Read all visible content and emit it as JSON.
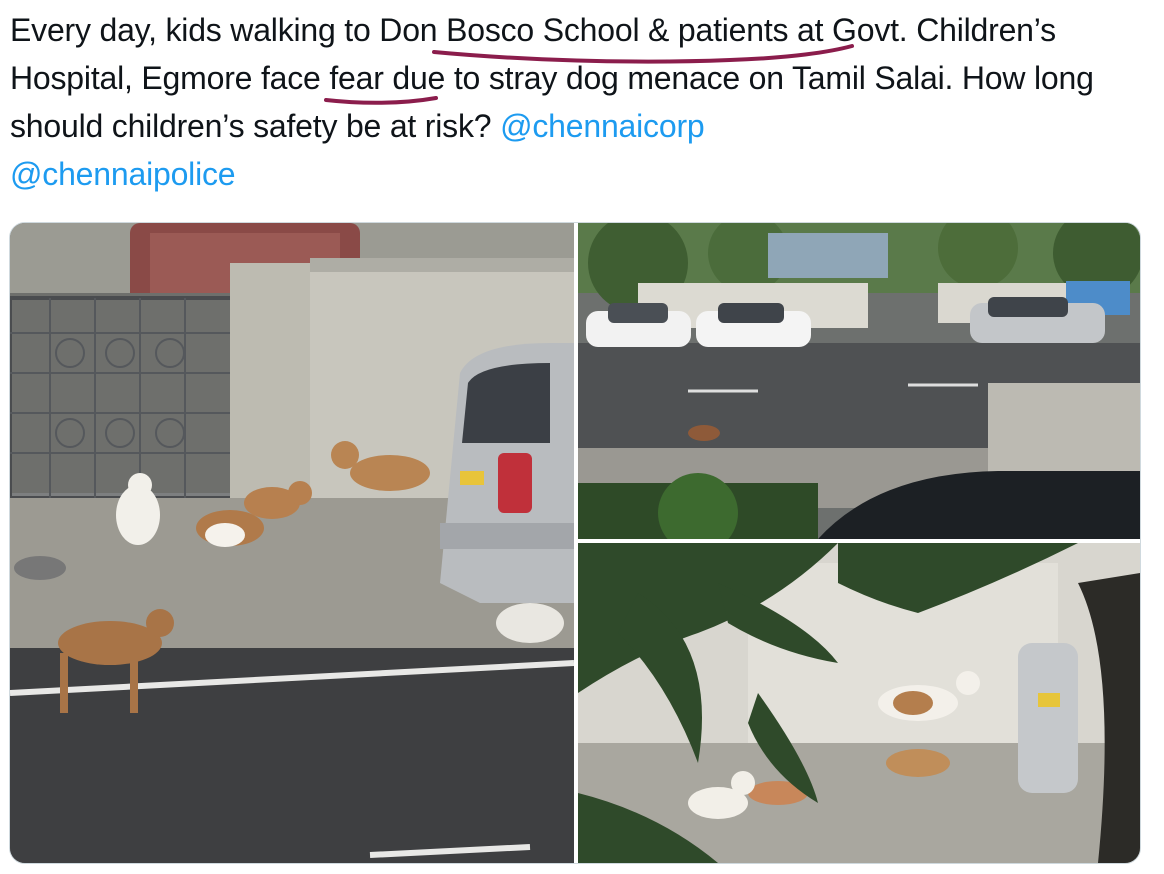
{
  "tweet": {
    "text_part_1": " Every day, kids walking to ",
    "text_part_2": "Don Bosco School & patients",
    "text_part_3": " at Govt. Children’s Hospital, ",
    "text_part_4": "Egmore",
    "text_part_5": " face fear due to stray dog menace on Tamil Salai. How long should children’s safety be at risk? ",
    "mention_1": "@chennaicorp",
    "mention_2": "@chennaipolice"
  },
  "media": {
    "photos": [
      {
        "name": "stray-dogs-near-gate-photo",
        "icon": "photo"
      },
      {
        "name": "street-with-stray-dogs-photo",
        "icon": "photo"
      },
      {
        "name": "dogs-under-tree-photo",
        "icon": "photo"
      }
    ]
  },
  "colors": {
    "mention": "#1d9bf0",
    "underline_ink": "#8b1d4c",
    "text": "#0f1419",
    "border": "#cfd9de"
  }
}
